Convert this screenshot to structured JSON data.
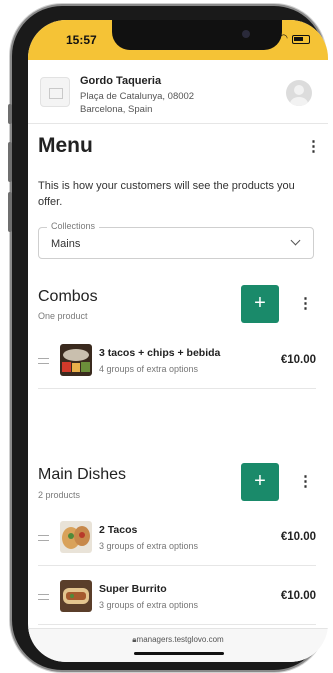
{
  "status_bar": {
    "time": "15:57"
  },
  "store": {
    "name": "Gordo Taqueria",
    "address_line1": "Plaça de Catalunya, 08002",
    "address_line2": "Barcelona, Spain"
  },
  "page": {
    "title": "Menu",
    "description": "This is how your customers will see the products you offer."
  },
  "collections": {
    "label": "Collections",
    "value": "Mains"
  },
  "sections": [
    {
      "title": "Combos",
      "count": "One product",
      "add_label": "+",
      "items": [
        {
          "name": "3 tacos + chips + bebida",
          "options": "4 groups of extra options",
          "price": "€10.00"
        }
      ]
    },
    {
      "title": "Main Dishes",
      "count": "2 products",
      "add_label": "+",
      "items": [
        {
          "name": "2 Tacos",
          "options": "3 groups of extra options",
          "price": "€10.00"
        },
        {
          "name": "Super Burrito",
          "options": "3 groups of extra options",
          "price": "€10.00"
        }
      ]
    }
  ],
  "browser": {
    "url": "managers.testglovo.com"
  },
  "colors": {
    "brand_yellow": "#f5c336",
    "accent_green": "#1a8a6a"
  }
}
